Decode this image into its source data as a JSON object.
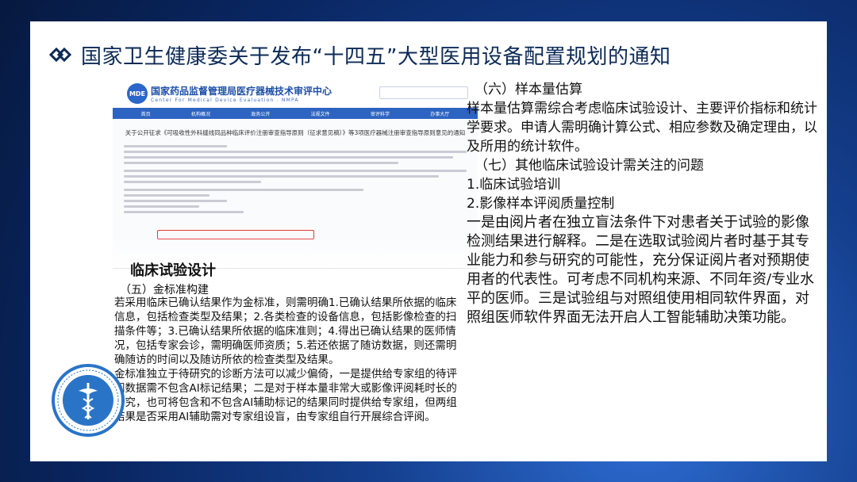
{
  "title": "国家卫生健康委关于发布“十四五”大型医用设备配置规划的通知",
  "screenshot": {
    "logo_text": "MDE",
    "org_cn": "国家药品监督管理局医疗器械技术审评中心",
    "org_en": "Center For Medical Device Evaluation . NMPA",
    "nav": [
      "首页",
      "机构概况",
      "政务公开",
      "法规文件",
      "审评科学",
      "办事大厅"
    ],
    "doc_title": "关于公开征求《可吸收性外科缝线同品种临床评价注册审查指导原则（征求意见稿）》等3项医疗器械注册审查指导原则意见的通知"
  },
  "section_heading": "临床试验设计",
  "left": {
    "subheading": "（五）金标准构建",
    "para1": "若采用临床已确认结果作为金标准，则需明确1.已确认结果所依据的临床信息，包括检查类型及结果；2.各类检查的设备信息，包括影像检查的扫描条件等；3.已确认结果所依据的临床准则；4.得出已确认结果的医师情况，包括专家会诊，需明确医师资质；5.若还依据了随访数据，则还需明确随访的时间以及随访所依的检查类型及结果。",
    "para2": "金标准独立于待研究的诊断方法可以减少偏倚，一是提供给专家组的待评阅数据需不包含AI标记结果；二是对于样本量非常大或影像评阅耗时长的研究，也可将包含和不包含AI辅助标记的结果同时提供给专家组，但两组结果是否采用AI辅助需对专家组设盲，由专家组自行开展综合评阅。"
  },
  "right": {
    "sub6": "（六）样本量估算",
    "para6": "样本量估算需综合考虑临床试验设计、主要评价指标和统计学要求。申请人需明确计算公式、相应参数及确定理由，以及所用的统计软件。",
    "sub7": "（七）其他临床试验设计需关注的问题",
    "item1": "1.临床试验培训",
    "item2": "2.影像样本评阅质量控制",
    "para7": "一是由阅片者在独立盲法条件下对患者关于试验的影像检测结果进行解释。二是在选取试验阅片者时基于其专业能力和参与研究的可能性，充分保证阅片者对预期使用者的代表性。可考虑不同机构来源、不同年资/专业水平的医师。三是试验组与对照组使用相同软件界面，对照组医师软件界面无法开启人工智能辅助决策功能。"
  },
  "colors": {
    "title": "#0c2a57",
    "accent_blue": "#2d64c2",
    "highlight_red": "#e23a3a"
  }
}
